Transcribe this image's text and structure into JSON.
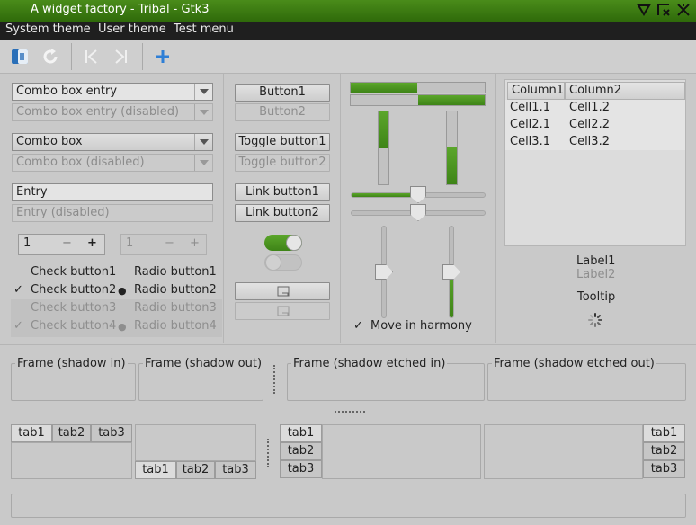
{
  "window": {
    "title": "A widget factory - Tribal - Gtk3"
  },
  "menubar": [
    "System theme",
    "User theme",
    "Test menu"
  ],
  "toolbar": {
    "items": [
      "document-icon",
      "refresh-icon",
      "skip-backward-icon",
      "skip-forward-icon",
      "add-icon"
    ]
  },
  "col1": {
    "combo_entry": "Combo box entry",
    "combo_entry_disabled": "Combo box entry (disabled)",
    "combo": "Combo box",
    "combo_disabled": "Combo box (disabled)",
    "entry": "Entry",
    "entry_disabled": "Entry (disabled)",
    "spin1_value": "1",
    "spin2_value": "1",
    "spin_minus": "−",
    "spin_plus": "+",
    "checks": [
      "Check button1",
      "Check button2",
      "Check button3",
      "Check button4"
    ],
    "radios": [
      "Radio button1",
      "Radio button2",
      "Radio button3",
      "Radio button4"
    ]
  },
  "col2": {
    "button1": "Button1",
    "button2": "Button2",
    "toggle1": "Toggle button1",
    "toggle2": "Toggle button2",
    "link1": "Link button1",
    "link2": "Link button2"
  },
  "col3": {
    "progress_h1": 0.5,
    "progress_h2": 0.5,
    "progress_v1": 0.5,
    "progress_v2": 0.5,
    "scale_h1": 0.5,
    "scale_h2": 0.5,
    "move_in_harmony": "Move in harmony"
  },
  "col4": {
    "tree": {
      "columns": [
        "Column1",
        "Column2"
      ],
      "rows": [
        [
          "Cell1.1",
          "Cell1.2"
        ],
        [
          "Cell2.1",
          "Cell2.2"
        ],
        [
          "Cell3.1",
          "Cell3.2"
        ]
      ]
    },
    "label1": "Label1",
    "label2": "Label2",
    "tooltip": "Tooltip"
  },
  "frames": [
    "Frame (shadow in)",
    "Frame (shadow out)",
    "Frame (shadow etched in)",
    "Frame (shadow etched out)"
  ],
  "tabs": [
    "tab1",
    "tab2",
    "tab3"
  ]
}
